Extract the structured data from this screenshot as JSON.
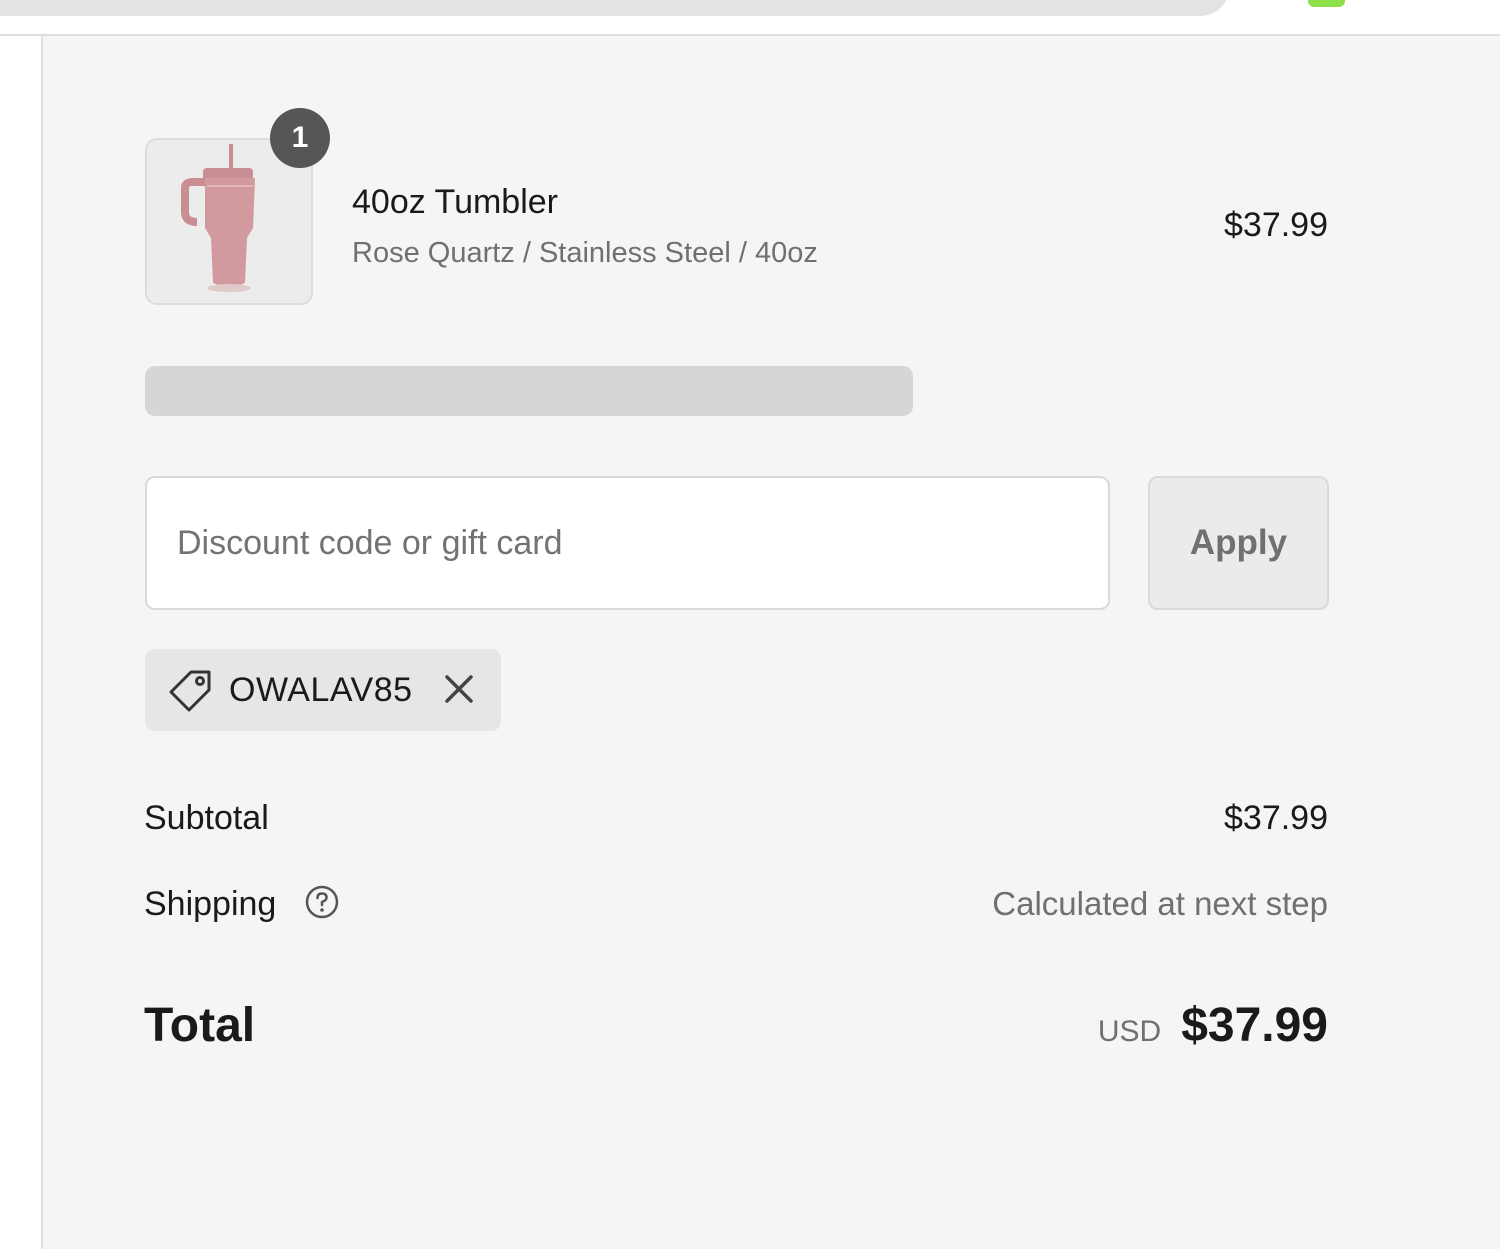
{
  "product": {
    "quantity": "1",
    "name": "40oz Tumbler",
    "variant": "Rose Quartz / Stainless Steel / 40oz",
    "price": "$37.99",
    "image_icon": "tumbler-image"
  },
  "discount": {
    "placeholder": "Discount code or gift card",
    "value": "",
    "apply_label": "Apply"
  },
  "applied_code": {
    "code": "OWALAV85",
    "tag_icon": "tag-icon",
    "remove_icon": "close-icon"
  },
  "totals": {
    "subtotal_label": "Subtotal",
    "subtotal_value": "$37.99",
    "shipping_label": "Shipping",
    "shipping_help_icon": "question-icon",
    "shipping_value": "Calculated at next step",
    "total_label": "Total",
    "currency": "USD",
    "total_value": "$37.99"
  },
  "colors": {
    "panel_background": "#f5f5f5",
    "badge": "#565656",
    "tumbler": "#d29a9e",
    "browser_indicator": "#8ee04a"
  }
}
